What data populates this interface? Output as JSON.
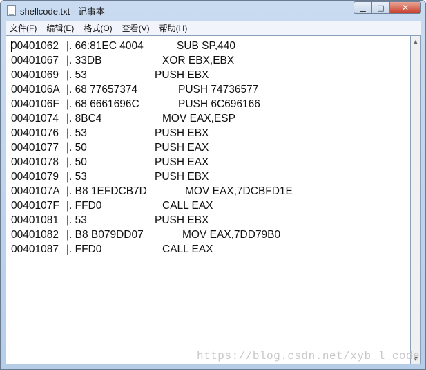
{
  "window": {
    "title": "shellcode.txt - 记事本",
    "controls": {
      "minimize": "▁",
      "maximize": "□",
      "close": "✕"
    }
  },
  "menu": [
    "文件(F)",
    "编辑(E)",
    "格式(O)",
    "查看(V)",
    "帮助(H)"
  ],
  "lines": [
    {
      "addr": "00401062",
      "bytes": "|. 66:81EC 4004",
      "instr": "SUB SP,440"
    },
    {
      "addr": "00401067",
      "bytes": "|. 33DB",
      "instr": "XOR EBX,EBX"
    },
    {
      "addr": "00401069",
      "bytes": "|. 53",
      "instr": "PUSH EBX"
    },
    {
      "addr": "0040106A",
      "bytes": "|. 68 77657374",
      "instr": "PUSH 74736577"
    },
    {
      "addr": "0040106F",
      "bytes": "|. 68 6661696C",
      "instr": "PUSH 6C696166"
    },
    {
      "addr": "00401074",
      "bytes": "|. 8BC4",
      "instr": "MOV EAX,ESP"
    },
    {
      "addr": "00401076",
      "bytes": "|. 53",
      "instr": "PUSH EBX"
    },
    {
      "addr": "00401077",
      "bytes": "|. 50",
      "instr": "PUSH EAX"
    },
    {
      "addr": "00401078",
      "bytes": "|. 50",
      "instr": "PUSH EAX"
    },
    {
      "addr": "00401079",
      "bytes": "|. 53",
      "instr": "PUSH EBX"
    },
    {
      "addr": "0040107A",
      "bytes": "|. B8 1EFDCB7D",
      "instr": "MOV EAX,7DCBFD1E"
    },
    {
      "addr": "0040107F",
      "bytes": "|. FFD0",
      "instr": "CALL EAX"
    },
    {
      "addr": "00401081",
      "bytes": "|. 53",
      "instr": "PUSH EBX"
    },
    {
      "addr": "00401082",
      "bytes": "|. B8 B079DD07",
      "instr": "MOV EAX,7DD79B0"
    },
    {
      "addr": "00401087",
      "bytes": "|. FFD0",
      "instr": "CALL EAX"
    }
  ],
  "watermark": "https://blog.csdn.net/xyb_l_code"
}
